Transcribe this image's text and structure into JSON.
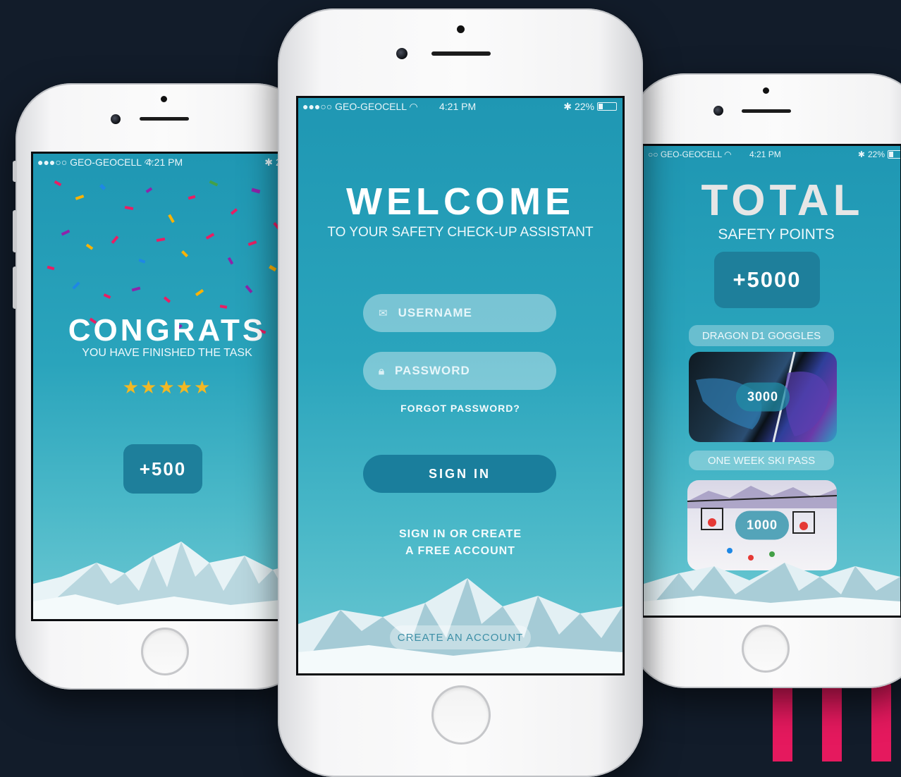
{
  "status": {
    "carrier": "GEO-GEOCELL",
    "time": "4:21 PM",
    "battery": "22%"
  },
  "left_screen": {
    "title": "CONGRATS",
    "subtitle": "YOU HAVE FINISHED THE TASK",
    "stars": "★★★★★",
    "points": "+500"
  },
  "center_screen": {
    "title": "WELCOME",
    "subtitle": "TO YOUR SAFETY CHECK-UP ASSISTANT",
    "username_placeholder": "USERNAME",
    "password_placeholder": "PASSWORD",
    "forgot": "FORGOT PASSWORD?",
    "sign_in": "SIGN IN",
    "info_line1": "SIGN IN OR CREATE",
    "info_line2": "A FREE ACCOUNT",
    "create_account": "CREATE AN ACCOUNT"
  },
  "right_screen": {
    "title": "TOTAL",
    "subtitle": "SAFETY POINTS",
    "points": "+5000",
    "prizes": [
      {
        "name": "DRAGON D1 GOGGLES",
        "cost": "3000"
      },
      {
        "name": "ONE WEEK SKI PASS",
        "cost": "1000"
      }
    ]
  },
  "colors": {
    "background": "#121c2a",
    "screen_teal": "#2aa4bc",
    "button_dark": "#1a7e9c",
    "accent_stripes": "#e5195e",
    "stars": "#f2b824"
  }
}
